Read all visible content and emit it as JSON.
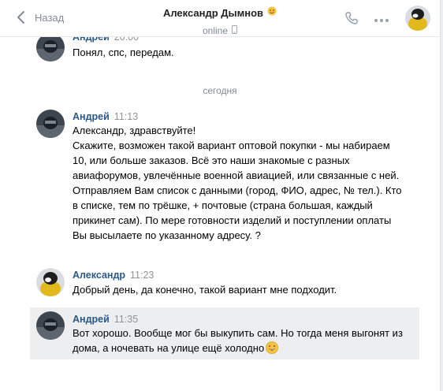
{
  "header": {
    "back_label": "Назад",
    "title": "Александр Дымнов",
    "status": "online"
  },
  "divider": {
    "label": "сегодня"
  },
  "messages": [
    {
      "author": "Андрей",
      "time": "20:00",
      "text": "Понял, спс, передам."
    },
    {
      "author": "Андрей",
      "time": "11:13",
      "text": "Александр, здравствуйте!\nСкажите, возможен такой вариант оптовой покупки - мы набираем 10, или больше заказов. Всё это наши знакомые с разных авиафорумов, увлечённые военной авиацией, или связанные с ней. Отправляем Вам список с данными (город, ФИО, адрес, № тел.). Кто в списке, тем по трёшке, + почтовые (страна большая, каждый прикинет сам). По мере готовности изделий и поступлении оплаты Вы высылаете по указанному адресу. ?"
    },
    {
      "author": "Александр",
      "time": "11:23",
      "text": "Добрый день, да конечно, такой вариант мне подходит."
    },
    {
      "author": "Андрей",
      "time": "11:35",
      "text": "Вот хорошо. Вообще мог бы выкупить сам. Но тогда меня выгонят из дома, а ночевать на улице ещё холодно"
    }
  ],
  "colors": {
    "link": "#2a5885",
    "muted": "#828a99",
    "selected_bg": "#edeef0"
  },
  "icons": {
    "back": "chevron-left-icon",
    "phone": "phone-icon",
    "more": "more-dots-icon",
    "status_device": "mobile-icon",
    "title_emoji": "emoji-icon",
    "message_emoji": "laughing-emoji-icon"
  }
}
